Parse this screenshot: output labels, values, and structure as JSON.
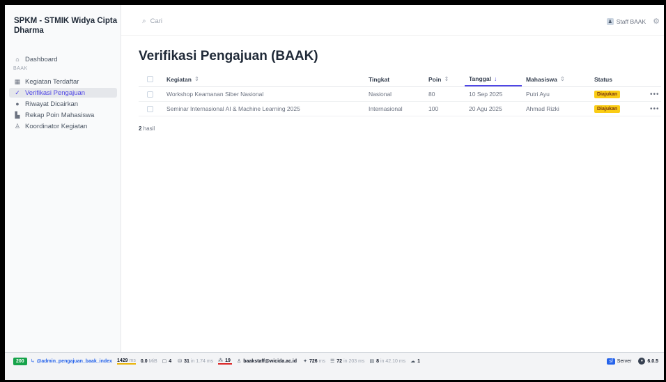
{
  "brand": {
    "title": "SPKM - STMIK Widya Cipta Dharma"
  },
  "sidebar": {
    "dashboard": "Dashboard",
    "section_label": "BAAK",
    "items": [
      {
        "label": "Kegiatan Terdaftar",
        "icon": "grid-icon"
      },
      {
        "label": "Verifikasi Pengajuan",
        "icon": "check-list-icon",
        "active": true
      },
      {
        "label": "Riwayat Dicairkan",
        "icon": "history-icon"
      },
      {
        "label": "Rekap Poin Mahasiswa",
        "icon": "chart-icon"
      },
      {
        "label": "Koordinator Kegiatan",
        "icon": "users-icon"
      }
    ]
  },
  "topbar": {
    "search_placeholder": "Cari",
    "user_name": "Staff BAAK"
  },
  "page": {
    "title": "Verifikasi Pengajuan (BAAK)"
  },
  "table": {
    "columns": [
      "Kegiatan",
      "Tingkat",
      "Poin",
      "Tanggal",
      "Mahasiswa",
      "Status"
    ],
    "rows": [
      {
        "kegiatan": "Workshop Keamanan Siber Nasional",
        "tingkat": "Nasional",
        "poin": "80",
        "tanggal": "10 Sep 2025",
        "mahasiswa": "Putri Ayu",
        "status": "Diajukan"
      },
      {
        "kegiatan": "Seminar Internasional AI & Machine Learning 2025",
        "tingkat": "Internasional",
        "poin": "100",
        "tanggal": "20 Agu 2025",
        "mahasiswa": "Ahmad Rizki",
        "status": "Diajukan"
      }
    ],
    "count_number": "2",
    "count_label": "hasil",
    "more_label": "•••"
  },
  "debugbar": {
    "status": "200",
    "route": "@admin_pengajuan_baak_index",
    "time": "1429",
    "time_unit": "ms",
    "memory": "0.0",
    "memory_unit": "MiB",
    "forms": "4",
    "cache": "31",
    "cache_detail": "in 1.74 ms",
    "translations": "19",
    "user": "baakstaff@wicida.ac.id",
    "twig": "726",
    "twig_unit": "ms",
    "doctrine": "72",
    "doctrine_detail": "in 203 ms",
    "db": "8",
    "db_detail": "in 42.10 ms",
    "ws": "1",
    "server": "Server",
    "version": "6.0.5",
    "status_color": "#16a34a"
  }
}
